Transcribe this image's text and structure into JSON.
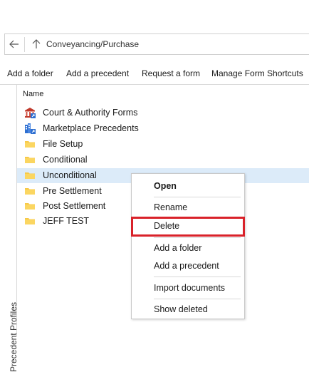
{
  "nav": {
    "path": "Conveyancing/Purchase"
  },
  "toolbar": {
    "add_folder": "Add a folder",
    "add_precedent": "Add a precedent",
    "request_form": "Request a form",
    "manage_shortcuts": "Manage Form Shortcuts"
  },
  "sidebar": {
    "label": "Precedent Profiles"
  },
  "list": {
    "column_header": "Name",
    "items": [
      {
        "label": "Court & Authority Forms",
        "icon": "court-building-icon"
      },
      {
        "label": "Marketplace Precedents",
        "icon": "marketplace-building-icon"
      },
      {
        "label": "File Setup",
        "icon": "folder-icon"
      },
      {
        "label": "Conditional",
        "icon": "folder-icon"
      },
      {
        "label": "Unconditional",
        "icon": "folder-icon",
        "selected": true
      },
      {
        "label": "Pre Settlement",
        "icon": "folder-icon"
      },
      {
        "label": "Post Settlement",
        "icon": "folder-icon"
      },
      {
        "label": "JEFF TEST",
        "icon": "folder-icon"
      }
    ]
  },
  "context_menu": {
    "open": "Open",
    "rename": "Rename",
    "delete": "Delete",
    "add_folder": "Add a folder",
    "add_precedent": "Add a precedent",
    "import_documents": "Import documents",
    "show_deleted": "Show deleted"
  },
  "colors": {
    "selection": "#dcebf9",
    "highlight_box": "#d9222a",
    "folder": "#f7c948",
    "court_icon": "#c0392b",
    "marketplace_icon": "#2e6fd1"
  }
}
